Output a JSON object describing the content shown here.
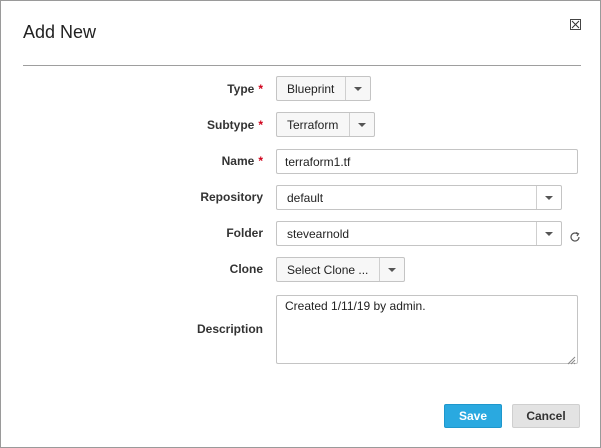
{
  "dialog": {
    "title": "Add New",
    "close_icon": "close-box-icon"
  },
  "form": {
    "type": {
      "label": "Type",
      "required_mark": "*",
      "value": "Blueprint"
    },
    "subtype": {
      "label": "Subtype",
      "required_mark": "*",
      "value": "Terraform"
    },
    "name": {
      "label": "Name",
      "required_mark": "*",
      "value": "terraform1.tf"
    },
    "repository": {
      "label": "Repository",
      "value": "default"
    },
    "folder": {
      "label": "Folder",
      "value": "stevearnold",
      "refresh_icon": "refresh-icon"
    },
    "clone": {
      "label": "Clone",
      "value": "Select Clone ..."
    },
    "description": {
      "label": "Description",
      "value": "Created 1/11/19 by admin."
    }
  },
  "actions": {
    "save_label": "Save",
    "cancel_label": "Cancel"
  },
  "colors": {
    "primary": "#2aa9e0",
    "required": "#d0021b"
  }
}
